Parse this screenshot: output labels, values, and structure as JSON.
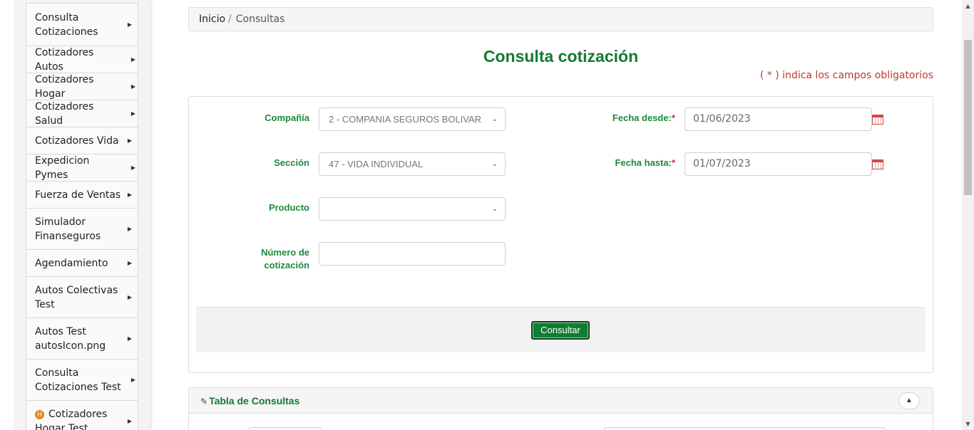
{
  "sidebar": {
    "items": [
      {
        "label": "Consulta Cotizaciones"
      },
      {
        "label": "Cotizadores Autos"
      },
      {
        "label": "Cotizadores Hogar"
      },
      {
        "label": "Cotizadores Salud"
      },
      {
        "label": "Cotizadores Vida"
      },
      {
        "label": "Expedicion Pymes"
      },
      {
        "label": "Fuerza de Ventas"
      },
      {
        "label": "Simulador Finanseguros"
      },
      {
        "label": "Agendamiento"
      },
      {
        "label": "Autos Colectivas Test"
      },
      {
        "label": "Autos Test autosIcon.png"
      },
      {
        "label": "Consulta Cotizaciones Test"
      },
      {
        "label": "Cotizadores Hogar Test",
        "badge": "H"
      }
    ]
  },
  "breadcrumb": {
    "home": "Inicio",
    "separator": "/",
    "current": "Consultas"
  },
  "page": {
    "title": "Consulta cotización",
    "required_note": "( * ) indica los campos obligatorios"
  },
  "form": {
    "compania": {
      "label": "Compañía",
      "value": "2 - COMPANIA SEGUROS BOLIVAR"
    },
    "seccion": {
      "label": "Sección",
      "value": "47 - VIDA INDIVIDUAL"
    },
    "producto": {
      "label": "Producto",
      "value": ""
    },
    "numero": {
      "label_line1": "Número de",
      "label_line2": "cotización",
      "value": ""
    },
    "fecha_desde": {
      "label": "Fecha desde:",
      "required_mark": "*",
      "value": "01/06/2023"
    },
    "fecha_hasta": {
      "label": "Fecha hasta:",
      "required_mark": "*",
      "value": "01/07/2023"
    },
    "submit_label": "Consultar"
  },
  "table_panel": {
    "title": "Tabla de Consultas"
  },
  "colors": {
    "brand_green": "#137a34",
    "label_green": "#1d8a3c",
    "required_red": "#c0392b",
    "button_green": "#0f7d33"
  }
}
